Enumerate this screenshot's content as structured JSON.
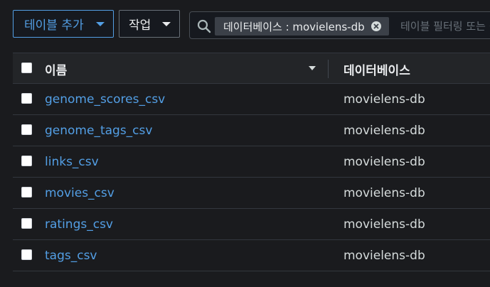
{
  "toolbar": {
    "add_table_label": "테이블 추가",
    "actions_label": "작업"
  },
  "search": {
    "token_label": "데이터베이스 : movielens-db",
    "placeholder": "테이블 필터링 또는 검색"
  },
  "table": {
    "headers": {
      "name": "이름",
      "database": "데이터베이스"
    },
    "rows": [
      {
        "name": "genome_scores_csv",
        "database": "movielens-db"
      },
      {
        "name": "genome_tags_csv",
        "database": "movielens-db"
      },
      {
        "name": "links_csv",
        "database": "movielens-db"
      },
      {
        "name": "movies_csv",
        "database": "movielens-db"
      },
      {
        "name": "ratings_csv",
        "database": "movielens-db"
      },
      {
        "name": "tags_csv",
        "database": "movielens-db"
      }
    ]
  },
  "colors": {
    "background": "#1a1b1e",
    "accent": "#539fe5",
    "text": "#e9ebed"
  }
}
